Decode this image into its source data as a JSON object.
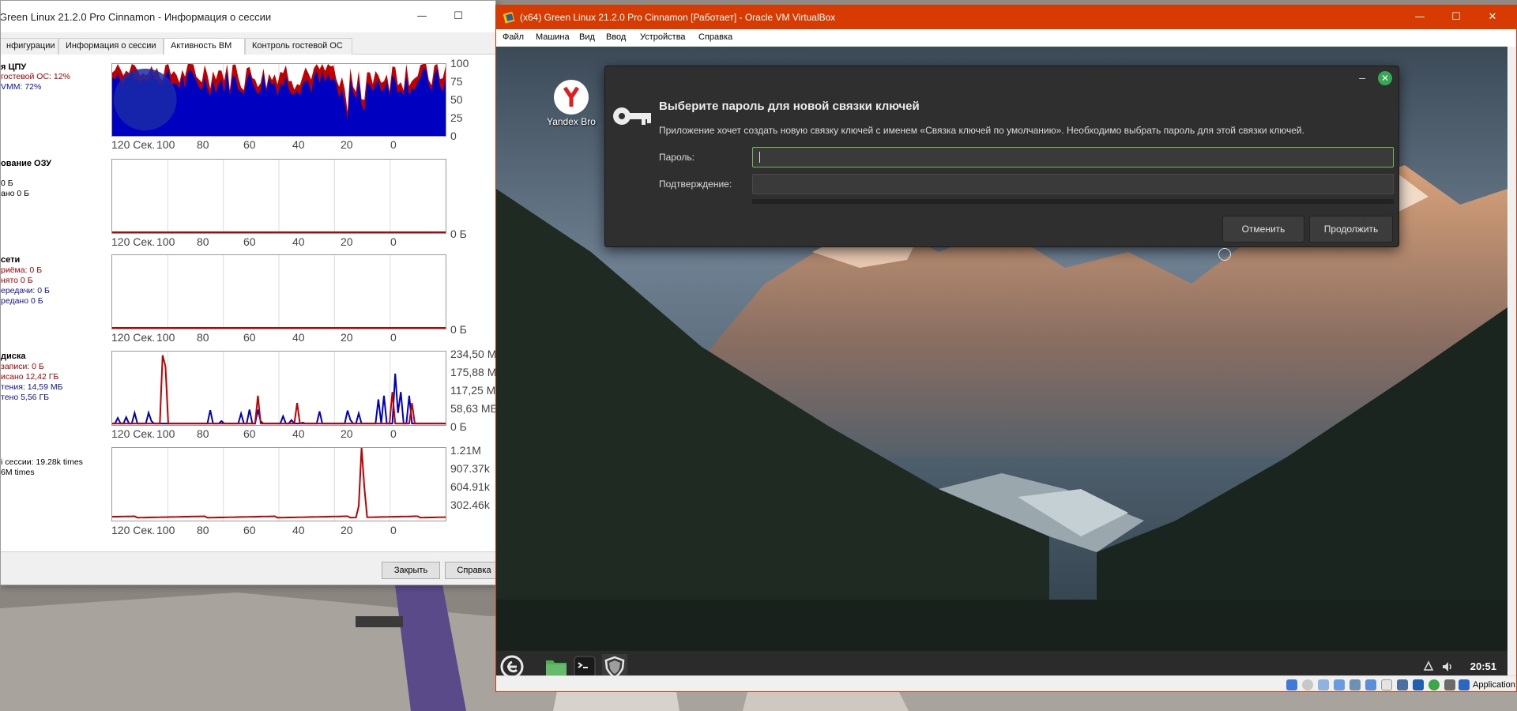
{
  "session_window": {
    "title": "Green Linux 21.2.0 Pro Cinnamon - Информация о сессии",
    "controls": [
      "—",
      "☐",
      "✕"
    ],
    "tabs": [
      "нфигурации",
      "Информация о сессии",
      "Активность ВМ",
      "Контроль гостевой ОС"
    ],
    "active_tab": "Активность ВМ",
    "x_ticks": [
      "120 Сек.",
      "100",
      "80",
      "60",
      "40",
      "20",
      "0"
    ],
    "cpu": {
      "title": "я ЦПУ",
      "legend": [
        {
          "text": "гостевой ОС: 12%",
          "color": "red"
        },
        {
          "text": "VMM: 72%",
          "color": "blue"
        }
      ],
      "y_ticks": [
        "100",
        "75",
        "50",
        "25",
        "0"
      ]
    },
    "ram": {
      "title": "ование ОЗУ",
      "legend": [
        {
          "text": "0 Б",
          "color": "black"
        },
        {
          "text": "ано 0 Б",
          "color": "black"
        }
      ],
      "y_ticks": [
        "0 Б"
      ]
    },
    "net": {
      "title": "сети",
      "legend": [
        {
          "text": "риёма: 0 Б",
          "color": "red"
        },
        {
          "text": "нято 0 Б",
          "color": "red"
        },
        {
          "text": "ередачи: 0 Б",
          "color": "blue"
        },
        {
          "text": "редано 0 Б",
          "color": "blue"
        }
      ],
      "y_ticks": [
        "0 Б"
      ]
    },
    "disk": {
      "title": "диска",
      "legend": [
        {
          "text": "записи: 0 Б",
          "color": "red"
        },
        {
          "text": "исано 12,42 ГБ",
          "color": "red"
        },
        {
          "text": "тения: 14,59 МБ",
          "color": "blue"
        },
        {
          "text": "тено 5,56 ГБ",
          "color": "blue"
        }
      ],
      "y_ticks": [
        "234,50 М",
        "175,88 М",
        "117,25 М",
        "58,63 МБ",
        "0 Б"
      ]
    },
    "exits": {
      "legend": [
        {
          "text": "і сессии: 19.28k times",
          "color": "black"
        },
        {
          "text": "6M times",
          "color": "black"
        }
      ],
      "y_ticks": [
        "1.21M",
        "907.37k",
        "604.91k",
        "302.46k"
      ]
    },
    "buttons": {
      "close": "Закрыть",
      "help": "Справка"
    }
  },
  "vbox_window": {
    "title": "(x64) Green Linux 21.2.0 Pro Cinnamon [Работает] - Oracle VM VirtualBox",
    "controls": [
      "—",
      "☐",
      "✕"
    ],
    "menu": [
      "Файл",
      "Машина",
      "Вид",
      "Ввод",
      "Устройства",
      "Справка"
    ],
    "statusbar_text": "Application"
  },
  "guest": {
    "desktop_icon_label": "Yandex Bro",
    "dialog": {
      "title": "Выберите пароль для новой связки ключей",
      "description": "Приложение хочет создать новую связку ключей с именем «Связка ключей по умолчанию». Необходимо выбрать пароль для этой связки ключей.",
      "password_label": "Пароль:",
      "confirm_label": "Подтверждение:",
      "password_value": "",
      "confirm_value": "",
      "cancel_label": "Отменить",
      "continue_label": "Продолжить",
      "minimize": "–",
      "close": "✕"
    },
    "panel": {
      "clock": "20:51"
    }
  },
  "colors": {
    "vbox_accent": "#d83b01",
    "series_red": "#c00000",
    "series_blue": "#0000c0",
    "mint_green": "#35a854"
  }
}
